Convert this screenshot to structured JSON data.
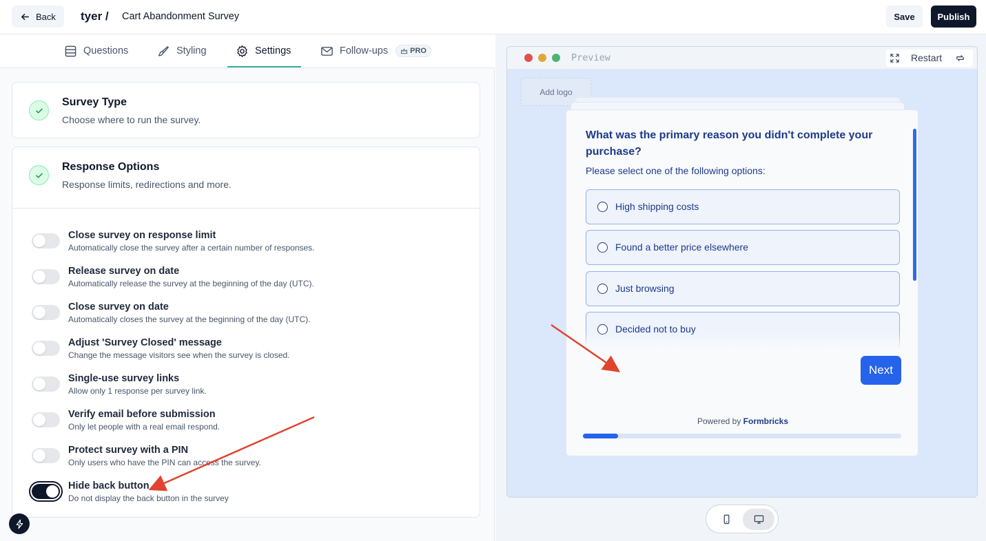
{
  "header": {
    "back_label": "Back",
    "environment": "tyer /",
    "survey_name": "Cart Abandonment Survey",
    "save_label": "Save",
    "publish_label": "Publish"
  },
  "tabs": [
    {
      "label": "Questions",
      "icon": "list-icon",
      "active": false
    },
    {
      "label": "Styling",
      "icon": "paintbrush-icon",
      "active": false
    },
    {
      "label": "Settings",
      "icon": "gear-icon",
      "active": true
    },
    {
      "label": "Follow-ups",
      "icon": "mail-icon",
      "active": false,
      "badge": "PRO"
    }
  ],
  "survey_type": {
    "title": "Survey Type",
    "subtitle": "Choose where to run the survey."
  },
  "response_options": {
    "title": "Response Options",
    "subtitle": "Response limits, redirections and more.",
    "items": [
      {
        "title": "Close survey on response limit",
        "desc": "Automatically close the survey after a certain number of responses.",
        "enabled": false
      },
      {
        "title": "Release survey on date",
        "desc": "Automatically release the survey at the beginning of the day (UTC).",
        "enabled": false
      },
      {
        "title": "Close survey on date",
        "desc": "Automatically closes the survey at the beginning of the day (UTC).",
        "enabled": false
      },
      {
        "title": "Adjust 'Survey Closed' message",
        "desc": "Change the message visitors see when the survey is closed.",
        "enabled": false
      },
      {
        "title": "Single-use survey links",
        "desc": "Allow only 1 response per survey link.",
        "enabled": false
      },
      {
        "title": "Verify email before submission",
        "desc": "Only let people with a real email respond.",
        "enabled": false
      },
      {
        "title": "Protect survey with a PIN",
        "desc": "Only users who have the PIN can access the survey.",
        "enabled": false
      },
      {
        "title": "Hide back button",
        "desc": "Do not display the back button in the survey",
        "enabled": true
      }
    ]
  },
  "preview": {
    "label": "Preview",
    "restart_label": "Restart",
    "add_logo_label": "Add logo",
    "question": {
      "headline": "What was the primary reason you didn't complete your purchase?",
      "subheader": "Please select one of the following options:",
      "choices": [
        "High shipping costs",
        "Found a better price elsewhere",
        "Just browsing",
        "Decided not to buy"
      ]
    },
    "next_label": "Next",
    "powered_by_prefix": "Powered by",
    "powered_by_brand": "Formbricks",
    "progress": 0.11,
    "device_mode": "desktop"
  },
  "colors": {
    "accent_tab": "#34b3a0",
    "brand": "#2563eb",
    "question_text": "#1e3a8a",
    "arrow": "#e0442e"
  }
}
